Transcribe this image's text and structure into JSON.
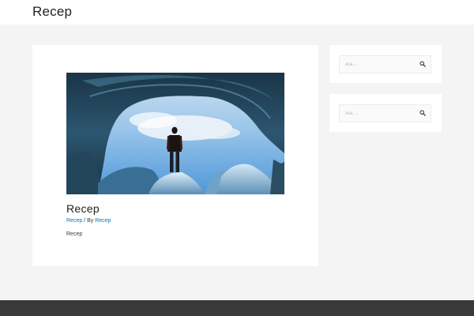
{
  "header": {
    "site_title": "Recep"
  },
  "post": {
    "title": "Recep",
    "meta": {
      "category": "Recep",
      "separator": " / By ",
      "author": "Recep"
    },
    "excerpt": "Recep",
    "image_icon": "ice-cave-photo"
  },
  "sidebar": {
    "widgets": [
      {
        "search_placeholder": "Ara ...",
        "icon": "search-icon"
      },
      {
        "search_placeholder": "Ara ...",
        "icon": "search-icon"
      }
    ]
  },
  "colors": {
    "link": "#0274be",
    "background": "#f4f4f4",
    "footer": "#3a3a3a"
  }
}
